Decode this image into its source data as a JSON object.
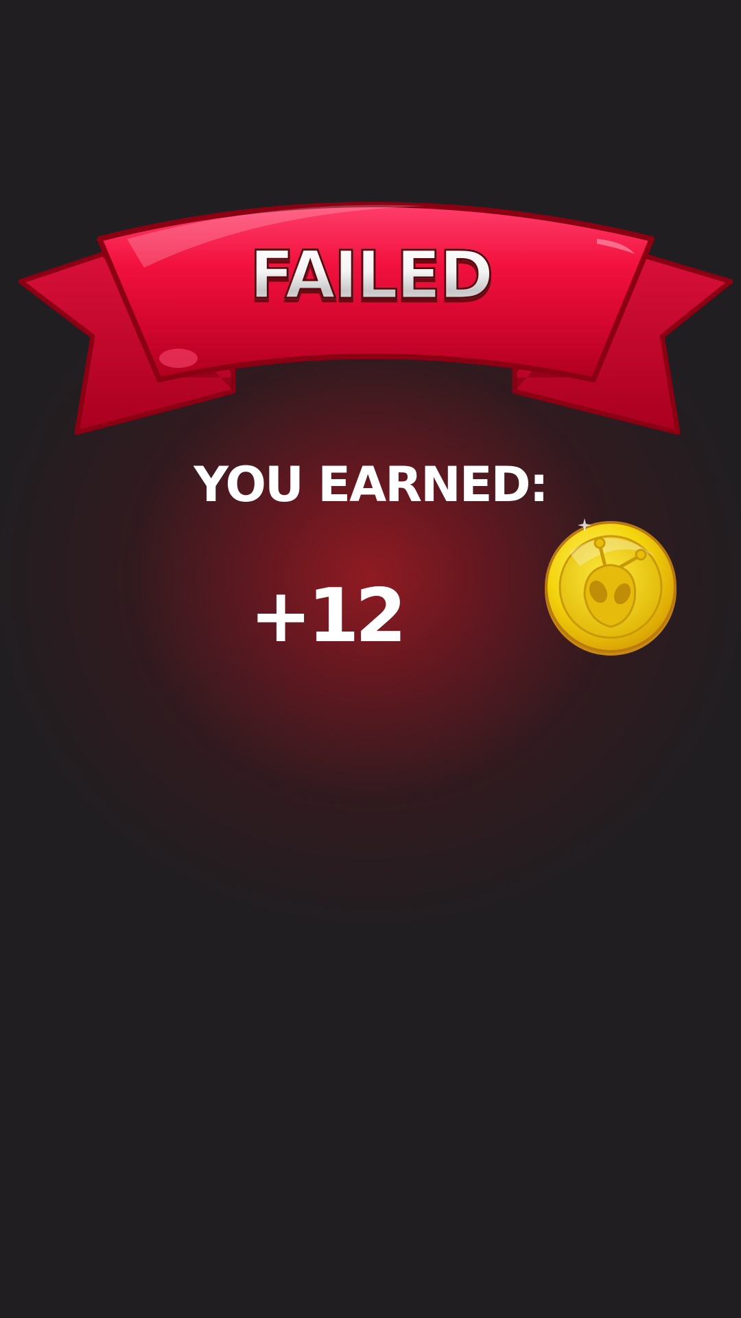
{
  "result": {
    "title": "FAILED"
  },
  "reward": {
    "label": "YOU EARNED:",
    "amount": "+12",
    "currency_icon": "alien-coin-icon"
  },
  "colors": {
    "background": "#201e21",
    "ribbon": "#e0103a",
    "coin": "#f4d60e"
  }
}
